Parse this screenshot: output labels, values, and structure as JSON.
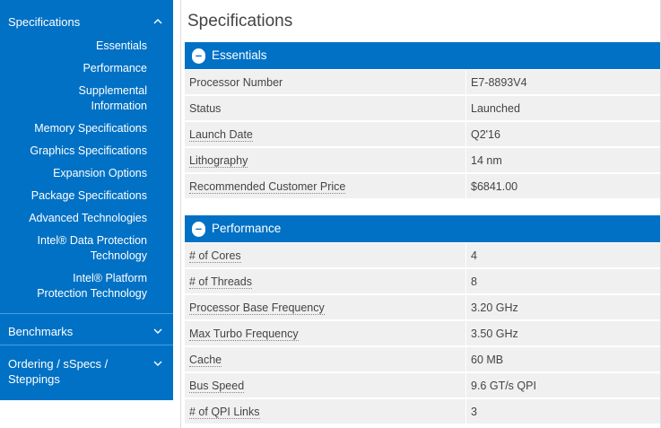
{
  "sidebar": {
    "header": {
      "label": "Specifications",
      "chevron": "^"
    },
    "links": [
      "Essentials",
      "Performance",
      "Supplemental Information",
      "Memory Specifications",
      "Graphics Specifications",
      "Expansion Options",
      "Package Specifications",
      "Advanced Technologies",
      "Intel® Data Protection Technology",
      "Intel® Platform Protection Technology"
    ],
    "benchmarks": {
      "label": "Benchmarks",
      "chevron": "⌄"
    },
    "ordering": {
      "label": "Ordering / sSpecs / Steppings",
      "chevron": "⌄"
    }
  },
  "main": {
    "title": "Specifications",
    "sections": [
      {
        "title": "Essentials",
        "toggle": "–",
        "rows": [
          {
            "label": "Processor Number",
            "value": "E7-8893V4",
            "tooltip": false
          },
          {
            "label": "Status",
            "value": "Launched",
            "tooltip": false
          },
          {
            "label": "Launch Date",
            "value": "Q2'16",
            "tooltip": true
          },
          {
            "label": "Lithography",
            "value": "14 nm",
            "tooltip": true
          },
          {
            "label": "Recommended Customer Price",
            "value": "$6841.00",
            "tooltip": true
          }
        ]
      },
      {
        "title": "Performance",
        "toggle": "–",
        "rows": [
          {
            "label": "# of Cores",
            "value": "4",
            "tooltip": true
          },
          {
            "label": "# of Threads",
            "value": "8",
            "tooltip": true
          },
          {
            "label": "Processor Base Frequency",
            "value": "3.20 GHz",
            "tooltip": true
          },
          {
            "label": "Max Turbo Frequency",
            "value": "3.50 GHz",
            "tooltip": true
          },
          {
            "label": "Cache",
            "value": "60 MB",
            "tooltip": true
          },
          {
            "label": "Bus Speed",
            "value": "9.6 GT/s QPI",
            "tooltip": true
          },
          {
            "label": "# of QPI Links",
            "value": "3",
            "tooltip": true
          }
        ]
      }
    ]
  },
  "colors": {
    "brand_blue": "#0071c5",
    "row_bg": "#f0f0f0"
  }
}
